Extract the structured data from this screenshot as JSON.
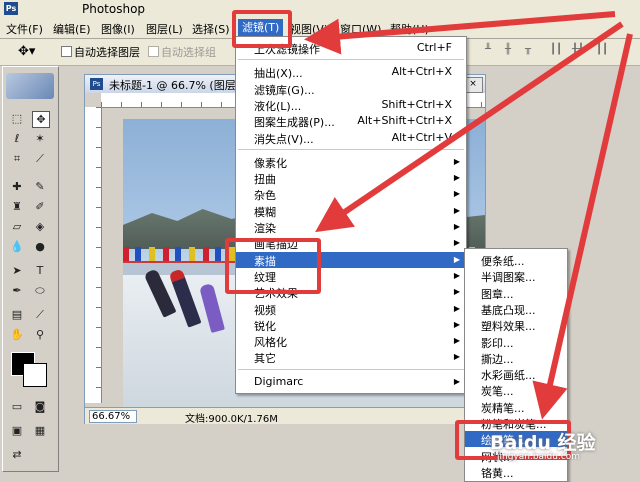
{
  "titlebar": {
    "app_icon": "Ps",
    "title": "Photoshop"
  },
  "menubar": {
    "items": [
      "文件(F)",
      "编辑(E)",
      "图像(I)",
      "图层(L)",
      "选择(S)",
      "滤镜(T)",
      "视图(V)",
      "窗口(W)",
      "帮助(H)"
    ],
    "active_index": 5
  },
  "options_bar": {
    "auto_select_layer": "自动选择图层",
    "auto_select_group": "自动选择组",
    "auto_select_group_enabled": false
  },
  "document": {
    "title": "未标题-1 @ 66.7% (图层",
    "zoom": "66.67%",
    "info": "文档:900.0K/1.76M",
    "window_buttons": [
      "_",
      "□",
      "×"
    ]
  },
  "filter_menu": {
    "items": [
      {
        "label": "上次滤镜操作",
        "shortcut": "Ctrl+F",
        "submenu": false
      },
      {
        "sep": true
      },
      {
        "label": "抽出(X)...",
        "shortcut": "Alt+Ctrl+X",
        "submenu": false
      },
      {
        "label": "滤镜库(G)...",
        "shortcut": "",
        "submenu": false
      },
      {
        "label": "液化(L)...",
        "shortcut": "Shift+Ctrl+X",
        "submenu": false
      },
      {
        "label": "图案生成器(P)...",
        "shortcut": "Alt+Shift+Ctrl+X",
        "submenu": false
      },
      {
        "label": "消失点(V)...",
        "shortcut": "Alt+Ctrl+V",
        "submenu": false
      },
      {
        "sep": true
      },
      {
        "label": "像素化",
        "shortcut": "",
        "submenu": true
      },
      {
        "label": "扭曲",
        "shortcut": "",
        "submenu": true
      },
      {
        "label": "杂色",
        "shortcut": "",
        "submenu": true
      },
      {
        "label": "模糊",
        "shortcut": "",
        "submenu": true
      },
      {
        "label": "渲染",
        "shortcut": "",
        "submenu": true
      },
      {
        "label": "画笔描边",
        "shortcut": "",
        "submenu": true
      },
      {
        "label": "素描",
        "shortcut": "",
        "submenu": true,
        "highlighted": true
      },
      {
        "label": "纹理",
        "shortcut": "",
        "submenu": true
      },
      {
        "label": "艺术效果",
        "shortcut": "",
        "submenu": true
      },
      {
        "label": "视频",
        "shortcut": "",
        "submenu": true
      },
      {
        "label": "锐化",
        "shortcut": "",
        "submenu": true
      },
      {
        "label": "风格化",
        "shortcut": "",
        "submenu": true
      },
      {
        "label": "其它",
        "shortcut": "",
        "submenu": true
      },
      {
        "sep": true
      },
      {
        "label": "Digimarc",
        "shortcut": "",
        "submenu": true
      }
    ]
  },
  "sketch_submenu": {
    "items": [
      {
        "label": "便条纸..."
      },
      {
        "label": "半调图案..."
      },
      {
        "label": "图章..."
      },
      {
        "label": "基底凸现..."
      },
      {
        "label": "塑料效果..."
      },
      {
        "label": "影印..."
      },
      {
        "label": "撕边..."
      },
      {
        "label": "水彩画纸..."
      },
      {
        "label": "炭笔..."
      },
      {
        "label": "炭精笔..."
      },
      {
        "label": "粉笔和炭笔..."
      },
      {
        "label": "绘图笔...",
        "highlighted": true
      },
      {
        "label": "网状..."
      },
      {
        "label": "铬黄..."
      }
    ]
  },
  "watermark": {
    "brand": "Baidu 经验",
    "url": "jingyan.baidu.com"
  },
  "annotation_color": "#e23b3b",
  "highlight_color": "#316ac5"
}
